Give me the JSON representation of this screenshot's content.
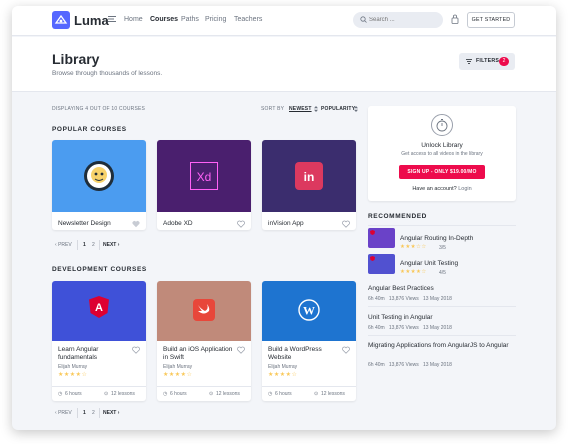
{
  "header": {
    "brand": "Luma",
    "nav": [
      "Home",
      "Courses",
      "Paths",
      "Pricing",
      "Teachers"
    ],
    "active_nav": "Courses",
    "search_placeholder": "Search ...",
    "get_started": "GET STARTED"
  },
  "page": {
    "title": "Library",
    "subtitle": "Browse through thousands of lessons.",
    "filters_label": "FILTERS",
    "filters_count": "2"
  },
  "toolbar": {
    "displaying": "DISPLAYING 4 OUT OF 10 COURSES",
    "sort_by": "SORT BY",
    "sort_newest": "NEWEST",
    "sort_popularity": "POPULARITY"
  },
  "popular": {
    "title": "POPULAR COURSES",
    "courses": [
      {
        "title": "Newsletter Design",
        "icon": "mailchimp-icon",
        "color": "#4b9cf0"
      },
      {
        "title": "Adobe XD",
        "icon": "adobe-xd-icon",
        "color": "#4a1f6e"
      },
      {
        "title": "inVision App",
        "icon": "invision-icon",
        "color": "#3b2d6e"
      }
    ],
    "pager": {
      "prev": "PREV",
      "pages": [
        "1",
        "2"
      ],
      "next": "NEXT"
    }
  },
  "development": {
    "title": "DEVELOPMENT COURSES",
    "courses": [
      {
        "title": "Learn Angular fundamentals",
        "author": "Elijah Murray",
        "stars": "★★★★☆",
        "hours": "6 hours",
        "lessons": "12 lessons",
        "icon": "angular-icon",
        "color": "#3f51d8"
      },
      {
        "title": "Build an iOS Application in Swift",
        "author": "Elijah Murray",
        "stars": "★★★★☆",
        "hours": "6 hours",
        "lessons": "12 lessons",
        "icon": "swift-icon",
        "color": "#c08a7a"
      },
      {
        "title": "Build a WordPress Website",
        "author": "Elijah Murray",
        "stars": "★★★★☆",
        "hours": "6 hours",
        "lessons": "12 lessons",
        "icon": "wordpress-icon",
        "color": "#1e74d0"
      }
    ],
    "pager": {
      "prev": "PREV",
      "pages": [
        "1",
        "2"
      ],
      "next": "NEXT"
    }
  },
  "unlock": {
    "title": "Unlock Library",
    "subtitle": "Get access to all videos in the library",
    "signup": "SIGN UP - ONLY $19.00/MO",
    "have_account": "Have an account?",
    "login": "Login"
  },
  "recommended": {
    "title": "RECOMMENDED",
    "items": [
      {
        "title": "Angular Routing In-Depth",
        "stars": "★★★☆☆",
        "score": "3/5",
        "color": "#6a42c8"
      },
      {
        "title": "Angular Unit Testing",
        "stars": "★★★★☆",
        "score": "4/5",
        "color": "#5151d0"
      }
    ],
    "lessons": [
      {
        "title": "Angular Best Practices",
        "hours": "6h 40m",
        "views": "13,876 Views",
        "date": "13 May 2018"
      },
      {
        "title": "Unit Testing in Angular",
        "hours": "6h 40m",
        "views": "13,876 Views",
        "date": "13 May 2018"
      },
      {
        "title": "Migrating Applications from AngularJS to Angular",
        "hours": "6h 40m",
        "views": "13,876 Views",
        "date": "13 May 2018"
      }
    ]
  }
}
